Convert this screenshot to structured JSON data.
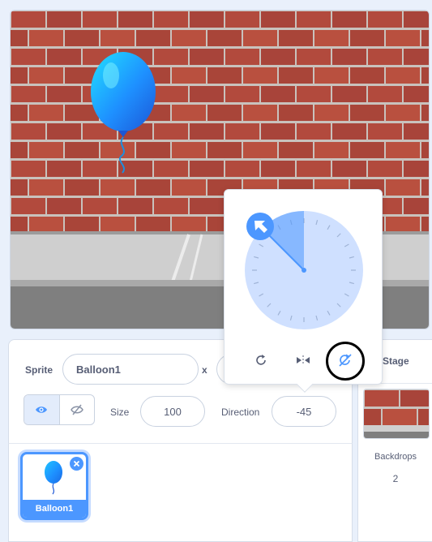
{
  "sprite_info": {
    "sprite_label": "Sprite",
    "sprite_name": "Balloon1",
    "x_label": "x",
    "size_label": "Size",
    "size_value": "100",
    "direction_label": "Direction",
    "direction_value": "-45"
  },
  "sprite_list": {
    "items": [
      {
        "name": "Balloon1",
        "selected": true
      }
    ]
  },
  "stage_panel": {
    "title": "Stage",
    "backdrops_label": "Backdrops",
    "backdrops_count": "2"
  },
  "direction_popover": {
    "direction_degrees": -45,
    "rotation_modes": [
      "all-around",
      "left-right",
      "dont-rotate"
    ],
    "selected_mode": "dont-rotate"
  },
  "colors": {
    "accent": "#4c97ff",
    "dial_fill": "#cfe0ff",
    "brick": "#b24a3d",
    "mortar": "#c9c2bd",
    "balloon": "#1e90ff"
  },
  "icons": {
    "show": "eye-icon",
    "hide": "eye-crossed-icon",
    "all_around": "rotate-all-around-icon",
    "left_right": "flip-left-right-icon",
    "dont_rotate": "dont-rotate-icon",
    "direction_handle": "arrow-up-left-icon",
    "delete": "close-icon"
  }
}
